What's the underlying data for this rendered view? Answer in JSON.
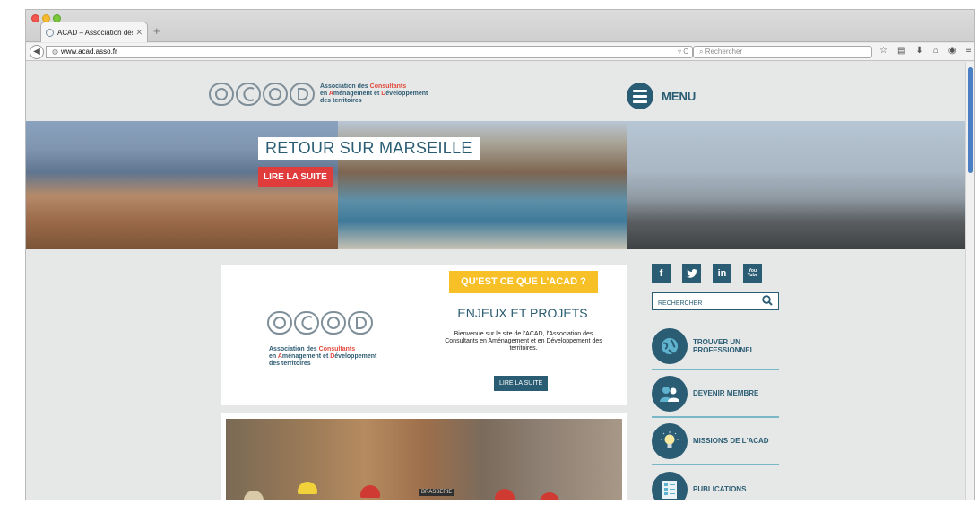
{
  "browser": {
    "tab_title": "ACAD – Association des C...",
    "tab_close": "✕",
    "new_tab": "+",
    "url": "www.acad.asso.fr",
    "search_placeholder": "Rechercher"
  },
  "site": {
    "logo_line1_pre": "Association des ",
    "logo_line1_hl": "Consultants",
    "logo_line2_pre": "en ",
    "logo_line2_hl1": "A",
    "logo_line2_mid": "ménagement et ",
    "logo_line2_hl2": "D",
    "logo_line2_post": "éveloppement",
    "logo_line3": "des territoires",
    "menu_label": "MENU"
  },
  "hero": {
    "title": "RETOUR SUR MARSEILLE",
    "button": "LIRE LA SUITE"
  },
  "card": {
    "badge": "QU'EST CE QUE L'ACAD ?",
    "heading": "ENJEUX ET PROJETS",
    "description": "Bienvenue sur le site de l'ACAD, l'Association des Consultants en Aménagement et en Développement des territoires.",
    "button": "LIRE LA SUITE"
  },
  "card2": {
    "sign": "BRASSERIE"
  },
  "sidebar": {
    "social": [
      "f",
      "t",
      "in",
      "You Tube"
    ],
    "search_placeholder": "RECHERCHER",
    "links": [
      "TROUVER UN PROFESSIONNEL",
      "DEVENIR MEMBRE",
      "MISSIONS DE L'ACAD",
      "PUBLICATIONS"
    ]
  },
  "colors": {
    "brand": "#2a5d73",
    "accent_red": "#e03c3c",
    "accent_yellow": "#f8c027",
    "page_bg": "#e6e7e7"
  }
}
